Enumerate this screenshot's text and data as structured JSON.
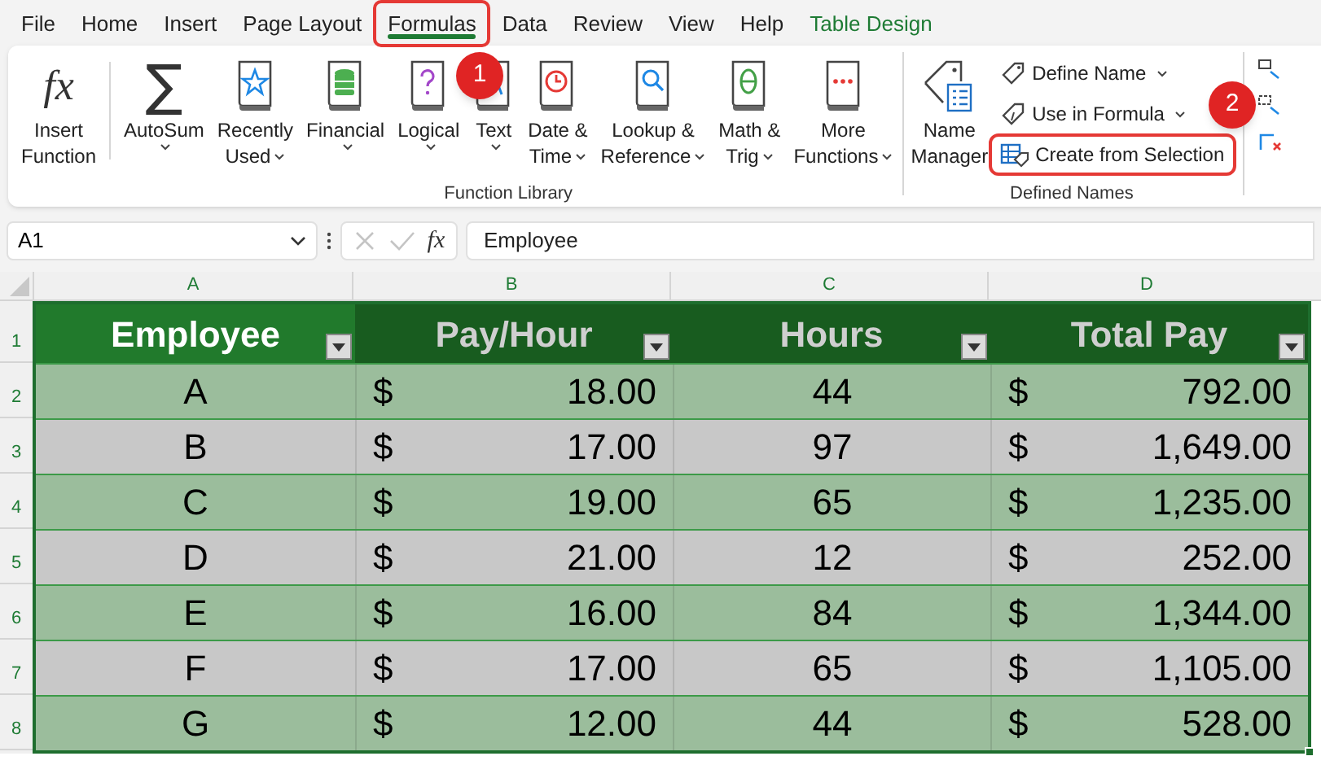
{
  "tabs": [
    {
      "label": "File",
      "selected": false,
      "highlighted": false,
      "kind": "plain"
    },
    {
      "label": "Home",
      "selected": false,
      "highlighted": false,
      "kind": "plain"
    },
    {
      "label": "Insert",
      "selected": false,
      "highlighted": false,
      "kind": "plain"
    },
    {
      "label": "Page Layout",
      "selected": false,
      "highlighted": false,
      "kind": "plain"
    },
    {
      "label": "Formulas",
      "selected": true,
      "highlighted": true,
      "kind": "plain"
    },
    {
      "label": "Data",
      "selected": false,
      "highlighted": false,
      "kind": "plain"
    },
    {
      "label": "Review",
      "selected": false,
      "highlighted": false,
      "kind": "plain"
    },
    {
      "label": "View",
      "selected": false,
      "highlighted": false,
      "kind": "plain"
    },
    {
      "label": "Help",
      "selected": false,
      "highlighted": false,
      "kind": "plain"
    },
    {
      "label": "Table Design",
      "selected": false,
      "highlighted": false,
      "kind": "contextual"
    }
  ],
  "ribbon": {
    "insert_function": {
      "glyph": "fx",
      "lines": [
        "Insert",
        "Function"
      ]
    },
    "function_library": {
      "label": "Function Library",
      "buttons": [
        {
          "kind": "sigma",
          "glyph": "∑",
          "lines": [
            "AutoSum"
          ],
          "caret": true
        },
        {
          "kind": "star",
          "lines": [
            "Recently",
            "Used"
          ],
          "caret": true
        },
        {
          "kind": "database",
          "lines": [
            "Financial"
          ],
          "caret": true
        },
        {
          "kind": "question",
          "lines": [
            "Logical"
          ],
          "caret": true
        },
        {
          "kind": "letter",
          "lines": [
            "Text"
          ],
          "caret": true
        },
        {
          "kind": "clock",
          "lines": [
            "Date &",
            "Time"
          ],
          "caret": true
        },
        {
          "kind": "magnifier",
          "lines": [
            "Lookup &",
            "Reference"
          ],
          "caret": true
        },
        {
          "kind": "theta",
          "lines": [
            "Math &",
            "Trig"
          ],
          "caret": true
        },
        {
          "kind": "dots",
          "lines": [
            "More",
            "Functions"
          ],
          "caret": true
        }
      ]
    },
    "defined_names": {
      "label": "Defined Names",
      "name_manager": {
        "lines": [
          "Name",
          "Manager"
        ]
      },
      "items": [
        {
          "kind": "tag",
          "label": "Define Name",
          "caret": true,
          "highlighted": false
        },
        {
          "kind": "tag-fx",
          "label": "Use in Formula",
          "caret": true,
          "highlighted": false
        },
        {
          "kind": "grid-tag",
          "label": "Create from Selection",
          "caret": false,
          "highlighted": true
        }
      ]
    }
  },
  "callouts": [
    {
      "number": "1"
    },
    {
      "number": "2"
    }
  ],
  "formula_bar": {
    "name_box": "A1",
    "fx": "fx",
    "value": "Employee"
  },
  "sheet": {
    "columns": [
      "A",
      "B",
      "C",
      "D"
    ],
    "row_numbers": [
      "1",
      "2",
      "3",
      "4",
      "5",
      "6",
      "7",
      "8"
    ],
    "table": {
      "header": [
        {
          "label": "Employee",
          "selected": true
        },
        {
          "label": "Pay/Hour",
          "selected": false
        },
        {
          "label": "Hours",
          "selected": false
        },
        {
          "label": "Total Pay",
          "selected": false
        }
      ],
      "rows": [
        {
          "employee": "A",
          "pay": {
            "currency": "$",
            "amount": "18.00"
          },
          "hours": "44",
          "total": {
            "currency": "$",
            "amount": "792.00"
          }
        },
        {
          "employee": "B",
          "pay": {
            "currency": "$",
            "amount": "17.00"
          },
          "hours": "97",
          "total": {
            "currency": "$",
            "amount": "1,649.00"
          }
        },
        {
          "employee": "C",
          "pay": {
            "currency": "$",
            "amount": "19.00"
          },
          "hours": "65",
          "total": {
            "currency": "$",
            "amount": "1,235.00"
          }
        },
        {
          "employee": "D",
          "pay": {
            "currency": "$",
            "amount": "21.00"
          },
          "hours": "12",
          "total": {
            "currency": "$",
            "amount": "252.00"
          }
        },
        {
          "employee": "E",
          "pay": {
            "currency": "$",
            "amount": "16.00"
          },
          "hours": "84",
          "total": {
            "currency": "$",
            "amount": "1,344.00"
          }
        },
        {
          "employee": "F",
          "pay": {
            "currency": "$",
            "amount": "17.00"
          },
          "hours": "65",
          "total": {
            "currency": "$",
            "amount": "1,105.00"
          }
        },
        {
          "employee": "G",
          "pay": {
            "currency": "$",
            "amount": "12.00"
          },
          "hours": "44",
          "total": {
            "currency": "$",
            "amount": "528.00"
          }
        }
      ]
    }
  }
}
